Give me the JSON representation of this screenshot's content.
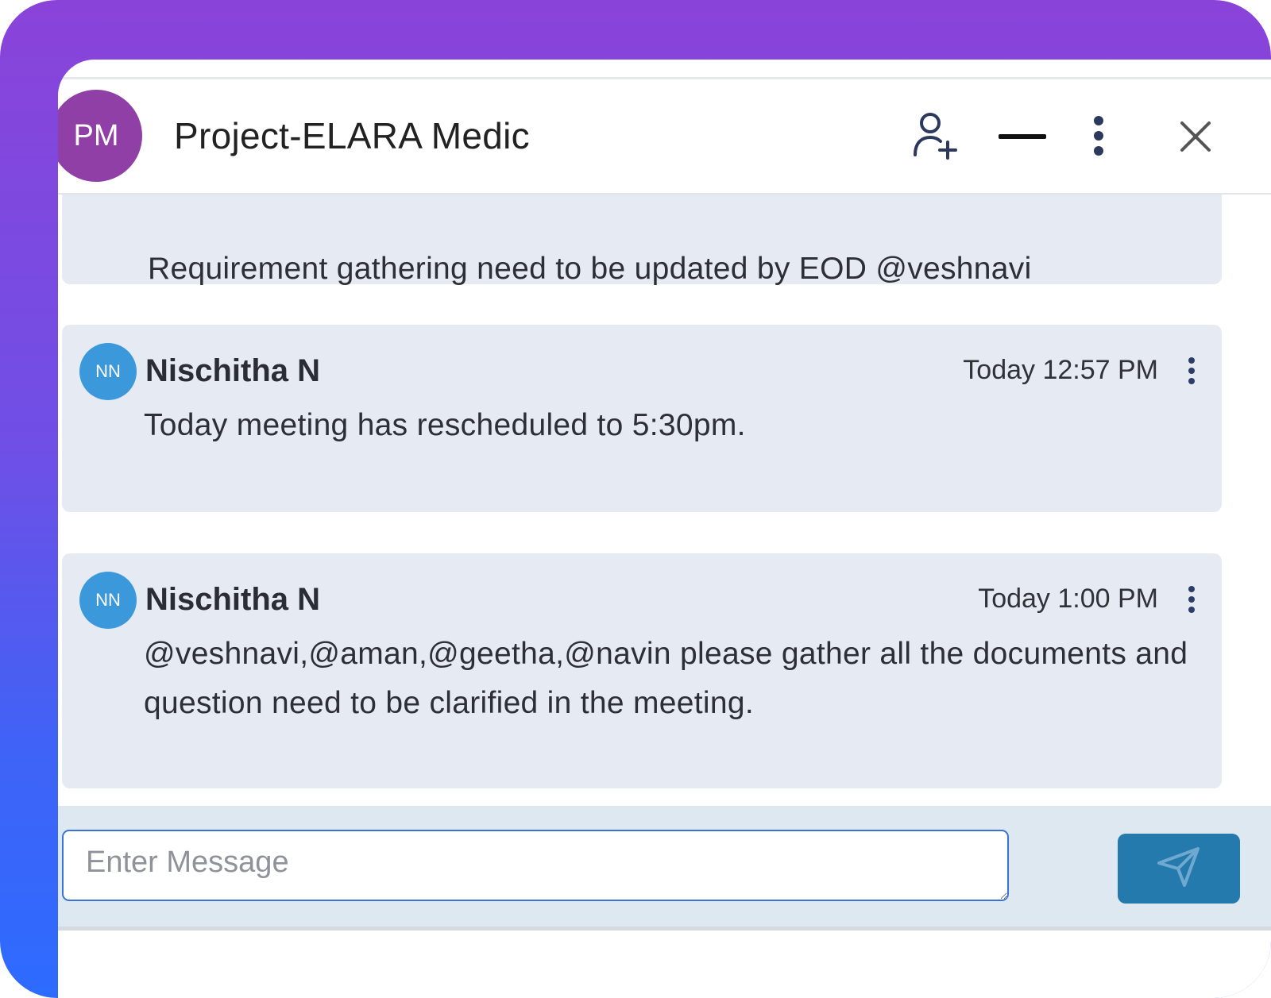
{
  "chat": {
    "avatar_initials": "PM",
    "title": "Project-ELARA Medic"
  },
  "header_icons": [
    "add-user-icon",
    "minimize-icon",
    "more-vertical-icon",
    "close-icon"
  ],
  "messages": [
    {
      "text": "Requirement gathering need to be updated by EOD @veshnavi"
    },
    {
      "initials": "NN",
      "author": "Nischitha N",
      "time": "Today 12:57 PM",
      "text": "Today meeting has rescheduled to 5:30pm."
    },
    {
      "initials": "NN",
      "author": "Nischitha N",
      "time": "Today 1:00 PM",
      "text": "@veshnavi,@aman,@geetha,@navin please gather all the documents and question need to be clarified in the meeting."
    }
  ],
  "composer": {
    "placeholder": "Enter Message",
    "value": ""
  },
  "colors": {
    "header_avatar": "#8f3fa5",
    "user_avatar": "#3a98db",
    "message_bg": "#e6eaf2",
    "send_button": "#2479ad",
    "frame_gradient_top": "#8a43d9",
    "frame_gradient_bottom": "#2d6bff"
  }
}
